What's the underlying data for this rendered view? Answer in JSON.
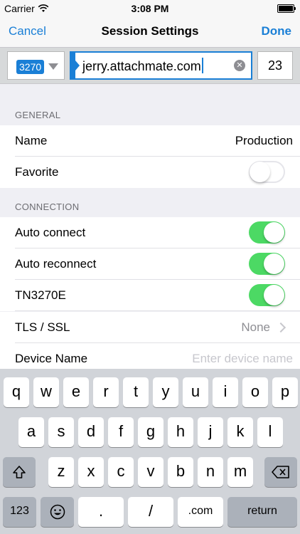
{
  "status": {
    "carrier": "Carrier",
    "time": "3:08 PM"
  },
  "nav": {
    "cancel": "Cancel",
    "title": "Session Settings",
    "done": "Done"
  },
  "host": {
    "type": "3270",
    "value": "jerry.attachmate.com",
    "port": "23"
  },
  "general": {
    "header": "GENERAL",
    "name_label": "Name",
    "name_value": "Production",
    "favorite_label": "Favorite",
    "favorite_on": false
  },
  "connection": {
    "header": "CONNECTION",
    "auto_connect": "Auto connect",
    "auto_reconnect": "Auto reconnect",
    "tn3270e": "TN3270E",
    "tls_label": "TLS / SSL",
    "tls_value": "None",
    "device_label": "Device Name",
    "device_placeholder": "Enter device name"
  },
  "keyboard": {
    "row1": [
      "q",
      "w",
      "e",
      "r",
      "t",
      "y",
      "u",
      "i",
      "o",
      "p"
    ],
    "row2": [
      "a",
      "s",
      "d",
      "f",
      "g",
      "h",
      "j",
      "k",
      "l"
    ],
    "row3": [
      "z",
      "x",
      "c",
      "v",
      "b",
      "n",
      "m"
    ],
    "numbers": "123",
    "dot": ".",
    "slash": "/",
    "com": ".com",
    "return": "return"
  },
  "colors": {
    "accent": "#1a7fd6",
    "toggle_on": "#4cd964"
  }
}
